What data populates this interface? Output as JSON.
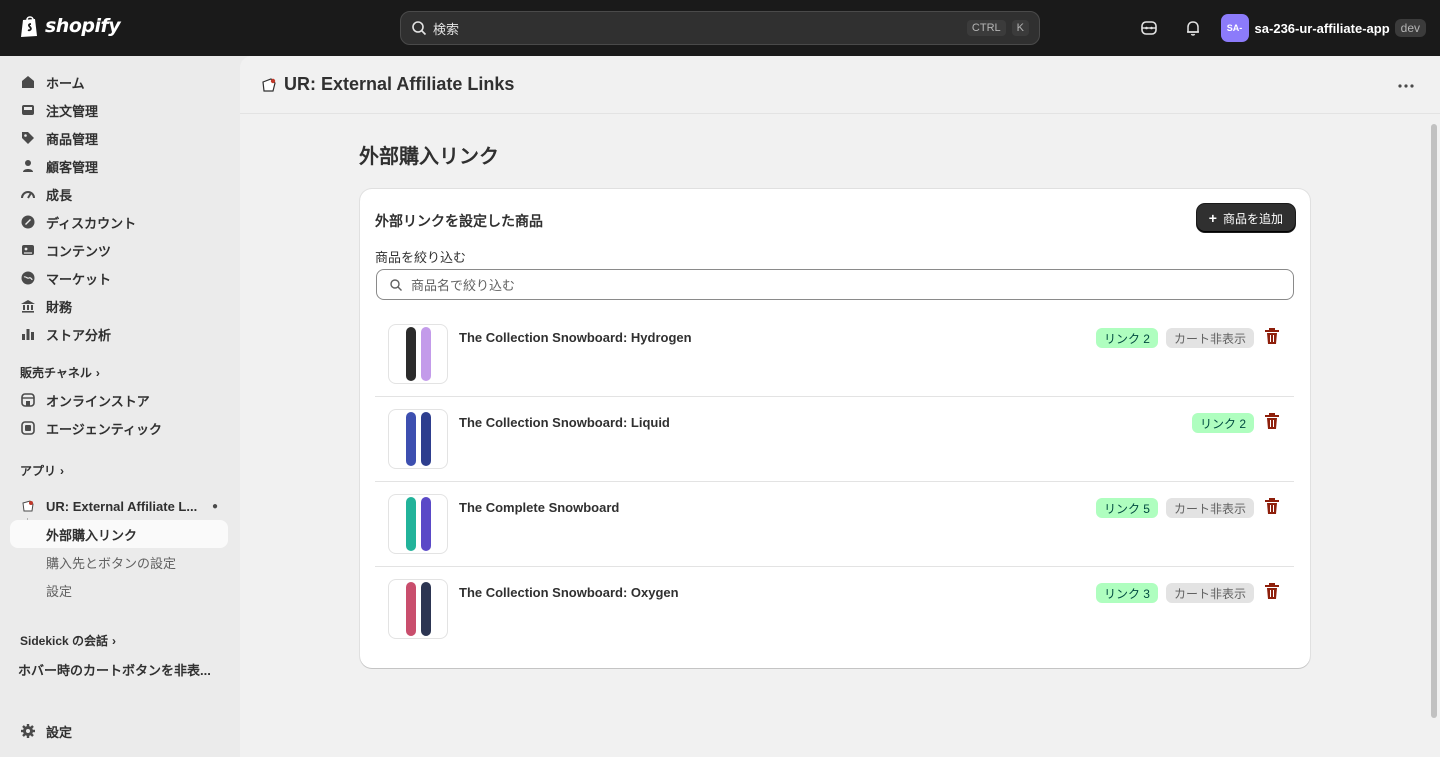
{
  "topbar": {
    "brand": "shopify",
    "search_placeholder": "検索",
    "shortcut_ctrl": "CTRL",
    "shortcut_key": "K",
    "avatar_initials": "SA-",
    "store_name": "sa-236-ur-affiliate-app",
    "env_badge": "dev"
  },
  "sidebar": {
    "items": [
      {
        "label": "ホーム",
        "icon": "home-icon"
      },
      {
        "label": "注文管理",
        "icon": "inbox-icon"
      },
      {
        "label": "商品管理",
        "icon": "tag-icon"
      },
      {
        "label": "顧客管理",
        "icon": "person-icon"
      },
      {
        "label": "成長",
        "icon": "gauge-icon"
      },
      {
        "label": "ディスカウント",
        "icon": "discount-icon"
      },
      {
        "label": "コンテンツ",
        "icon": "content-icon"
      },
      {
        "label": "マーケット",
        "icon": "globe-icon"
      },
      {
        "label": "財務",
        "icon": "bank-icon"
      },
      {
        "label": "ストア分析",
        "icon": "bar-chart-icon"
      }
    ],
    "sales_channels_heading": "販売チャネル",
    "channels": [
      {
        "label": "オンラインストア",
        "icon": "store-icon"
      },
      {
        "label": "エージェンティック",
        "icon": "agentic-icon"
      }
    ],
    "apps_heading": "アプリ",
    "app_name": "UR: External Affiliate L...",
    "app_subitems": [
      "外部購入リンク",
      "購入先とボタンの設定",
      "設定"
    ],
    "sidekick_heading": "Sidekick の会話",
    "sidekick_conversation": "ホバー時のカートボタンを非表...",
    "settings_label": "設定"
  },
  "app_header": {
    "title": "UR: External Affiliate Links"
  },
  "page": {
    "title": "外部購入リンク",
    "card_title": "外部リンクを設定した商品",
    "add_button": "商品を追加",
    "filter_label": "商品を絞り込む",
    "filter_placeholder": "商品名で絞り込む",
    "products": [
      {
        "name": "The Collection Snowboard: Hydrogen",
        "links": "リンク 2",
        "cart_hidden": "カート非表示",
        "boards": [
          "#2b2b2b",
          "#c39bea"
        ]
      },
      {
        "name": "The Collection Snowboard: Liquid",
        "links": "リンク 2",
        "cart_hidden": "",
        "boards": [
          "#3d4fb0",
          "#2e3e8e"
        ]
      },
      {
        "name": "The Complete Snowboard",
        "links": "リンク 5",
        "cart_hidden": "カート非表示",
        "boards": [
          "#22b39a",
          "#5a49c7"
        ]
      },
      {
        "name": "The Collection Snowboard: Oxygen",
        "links": "リンク 3",
        "cart_hidden": "カート非表示",
        "boards": [
          "#c94e6d",
          "#2c3552"
        ]
      }
    ]
  },
  "colors": {
    "topbar_bg": "#1a1a1a",
    "link_badge_bg": "#affebf",
    "delete_icon": "#8e1f0b",
    "primary_button": "#303030"
  }
}
